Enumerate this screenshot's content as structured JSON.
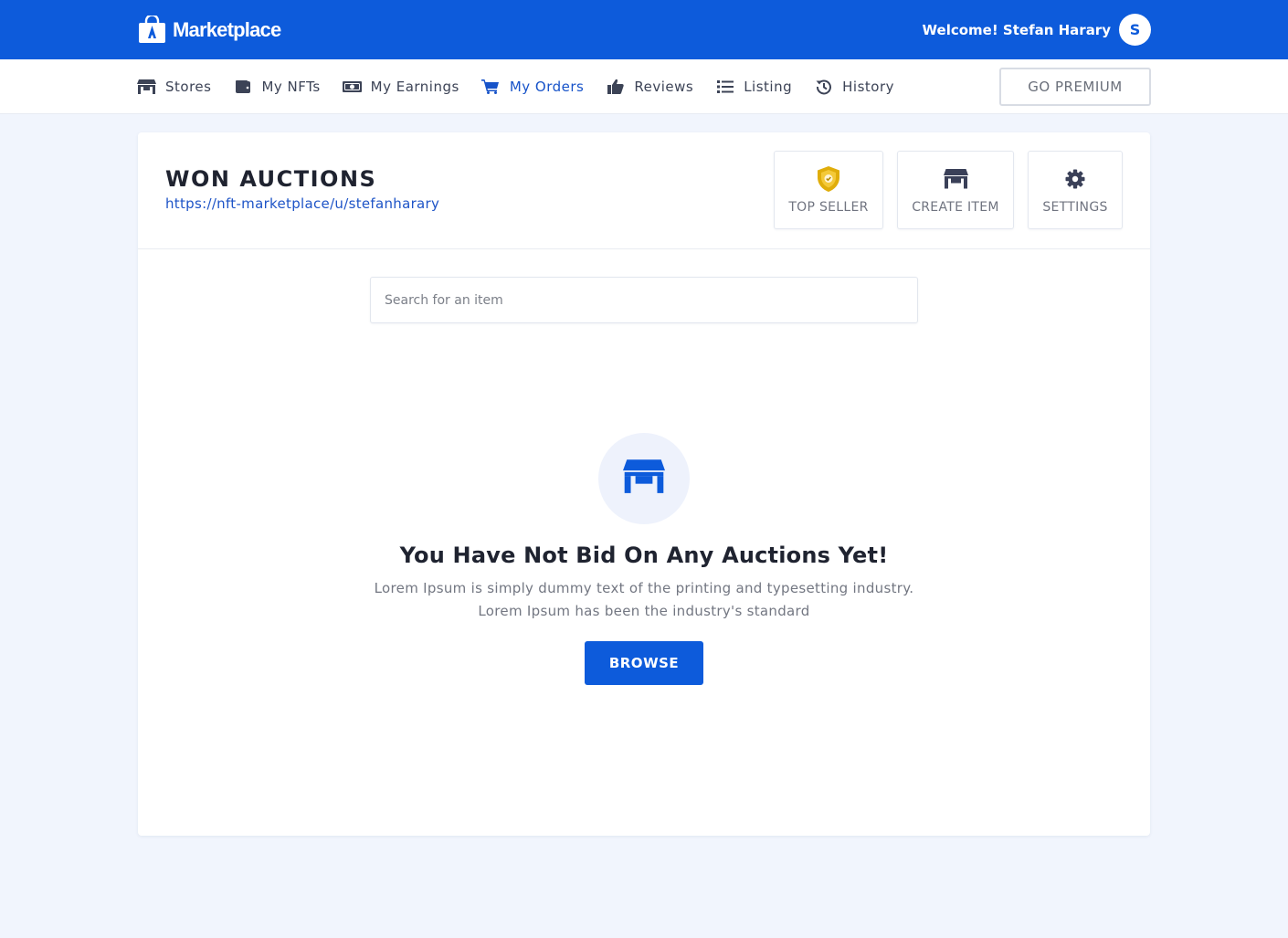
{
  "header": {
    "brand_name": "Marketplace",
    "welcome_text": "Welcome! Stefan Harary",
    "avatar_initial": "S"
  },
  "nav": {
    "items": [
      {
        "label": "Stores",
        "icon": "store-icon"
      },
      {
        "label": "My NFTs",
        "icon": "wallet-icon"
      },
      {
        "label": "My Earnings",
        "icon": "money-bill-icon"
      },
      {
        "label": "My Orders",
        "icon": "cart-icon",
        "active": true
      },
      {
        "label": "Reviews",
        "icon": "thumbs-up-icon"
      },
      {
        "label": "Listing",
        "icon": "list-icon"
      },
      {
        "label": "History",
        "icon": "history-icon"
      }
    ],
    "premium_label": "GO PREMIUM"
  },
  "page": {
    "title": "WON AUCTIONS",
    "profile_url": "https://nft-marketplace/u/stefanharary",
    "actions": {
      "top_seller": "TOP SELLER",
      "create_item": "CREATE ITEM",
      "settings": "SETTINGS"
    }
  },
  "search": {
    "placeholder": "Search for an item",
    "value": ""
  },
  "empty_state": {
    "title": "You Have Not Bid On Any Auctions Yet!",
    "line1": "Lorem Ipsum is simply dummy text of the printing and typesetting industry.",
    "line2": "Lorem Ipsum has been the industry's standard",
    "button_label": "BROWSE"
  },
  "colors": {
    "primary": "#0d5bdb",
    "active_link": "#1753c9",
    "background": "#f1f5fd",
    "badge_gold": "#e0ad0a"
  }
}
